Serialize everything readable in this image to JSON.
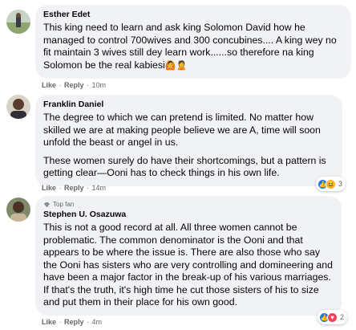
{
  "comments": [
    {
      "author": "Esther Edet",
      "paragraphs": [
        "This king need to learn and ask king Solomon David how he managed to control 700wives and 300 concubines.... A king wey no fit maintain 3 wives still dey learn work......so therefore na king Solomon be the real kabiesi"
      ],
      "emojis": "🙆🙎",
      "like": "Like",
      "reply": "Reply",
      "time": "10m"
    },
    {
      "author": "Franklin Daniel",
      "paragraphs": [
        "The degree to which we can pretend is limited. No matter how skilled we are at making people believe we are A, time will soon unfold the beast or angel in us.",
        "These women surely do have their shortcomings, but a pattern is getting clear—Ooni has to check things in his own life."
      ],
      "like": "Like",
      "reply": "Reply",
      "time": "14m",
      "reaction_count": "3",
      "reaction_icons": [
        "like-icon",
        "haha-icon"
      ]
    },
    {
      "badge": "Top fan",
      "author": "Stephen U. Osazuwa",
      "paragraphs": [
        "This is not a good record at all. All three women cannot be problematic. The common denominator is the Ooni and that appears to be where the issue is. There are also those who say the Ooni has sisters who are very controlling and domineering and have been a major factor in the break-up of his various marriages. If that's the truth, it's high time he cut those sisters of his to size and put them in their place for his own good."
      ],
      "like": "Like",
      "reply": "Reply",
      "time": "4m",
      "reaction_count": "2",
      "reaction_icons": [
        "like-icon",
        "love-icon"
      ]
    }
  ]
}
